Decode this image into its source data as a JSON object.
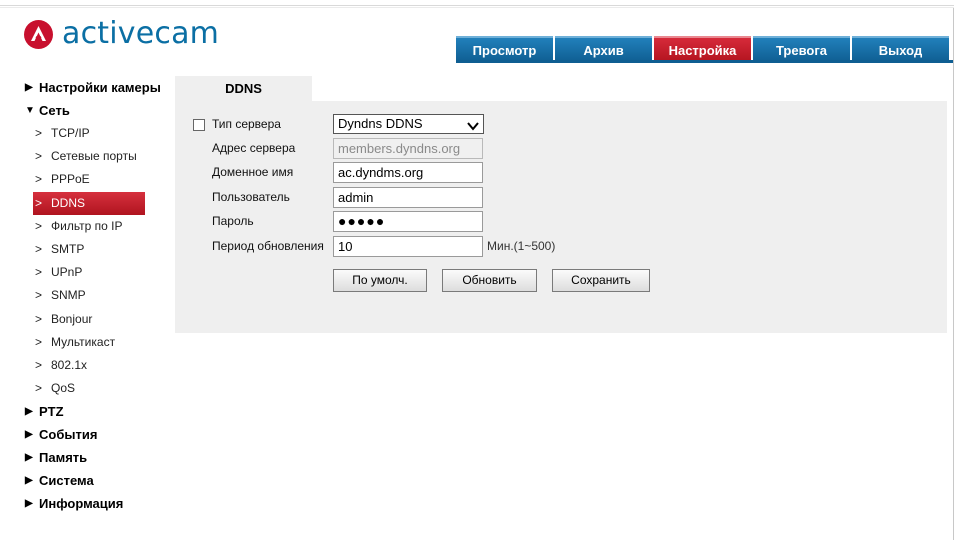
{
  "app": {
    "logo_text": "activecam",
    "brand_red": "#c8102e",
    "brand_blue": "#0b6fa4"
  },
  "nav": {
    "tabs": [
      {
        "label": "Просмотр",
        "active": false
      },
      {
        "label": "Архив",
        "active": false
      },
      {
        "label": "Настройка",
        "active": true
      },
      {
        "label": "Тревога",
        "active": false
      },
      {
        "label": "Выход",
        "active": false
      }
    ]
  },
  "sidebar": {
    "sections": [
      {
        "label": "Настройки камеры",
        "expanded": false
      },
      {
        "label": "Сеть",
        "expanded": true
      },
      {
        "label": "PTZ",
        "expanded": false
      },
      {
        "label": "События",
        "expanded": false
      },
      {
        "label": "Память",
        "expanded": false
      },
      {
        "label": "Система",
        "expanded": false
      },
      {
        "label": "Информация",
        "expanded": false
      }
    ],
    "network_items": [
      {
        "label": "TCP/IP"
      },
      {
        "label": "Сетевые порты"
      },
      {
        "label": "PPPoE"
      },
      {
        "label": "DDNS",
        "active": true
      },
      {
        "label": "Фильтр по IP"
      },
      {
        "label": "SMTP"
      },
      {
        "label": "UPnP"
      },
      {
        "label": "SNMP"
      },
      {
        "label": "Bonjour"
      },
      {
        "label": "Мультикаст"
      },
      {
        "label": "802.1x"
      },
      {
        "label": "QoS"
      }
    ]
  },
  "ddns": {
    "tab_label": "DDNS",
    "server_type_label": "Тип сервера",
    "server_type_enabled": false,
    "server_type_value": "Dyndns DDNS",
    "server_address_label": "Адрес сервера",
    "server_address_value": "members.dyndns.org",
    "domain_label": "Доменное имя",
    "domain_value": "ac.dyndms.org",
    "user_label": "Пользователь",
    "user_value": "admin",
    "password_label": "Пароль",
    "password_value": "●●●●●",
    "period_label": "Период обновления",
    "period_value": "10",
    "period_unit": "Мин.(1~500)",
    "btn_default": "По умолч.",
    "btn_refresh": "Обновить",
    "btn_save": "Сохранить"
  }
}
